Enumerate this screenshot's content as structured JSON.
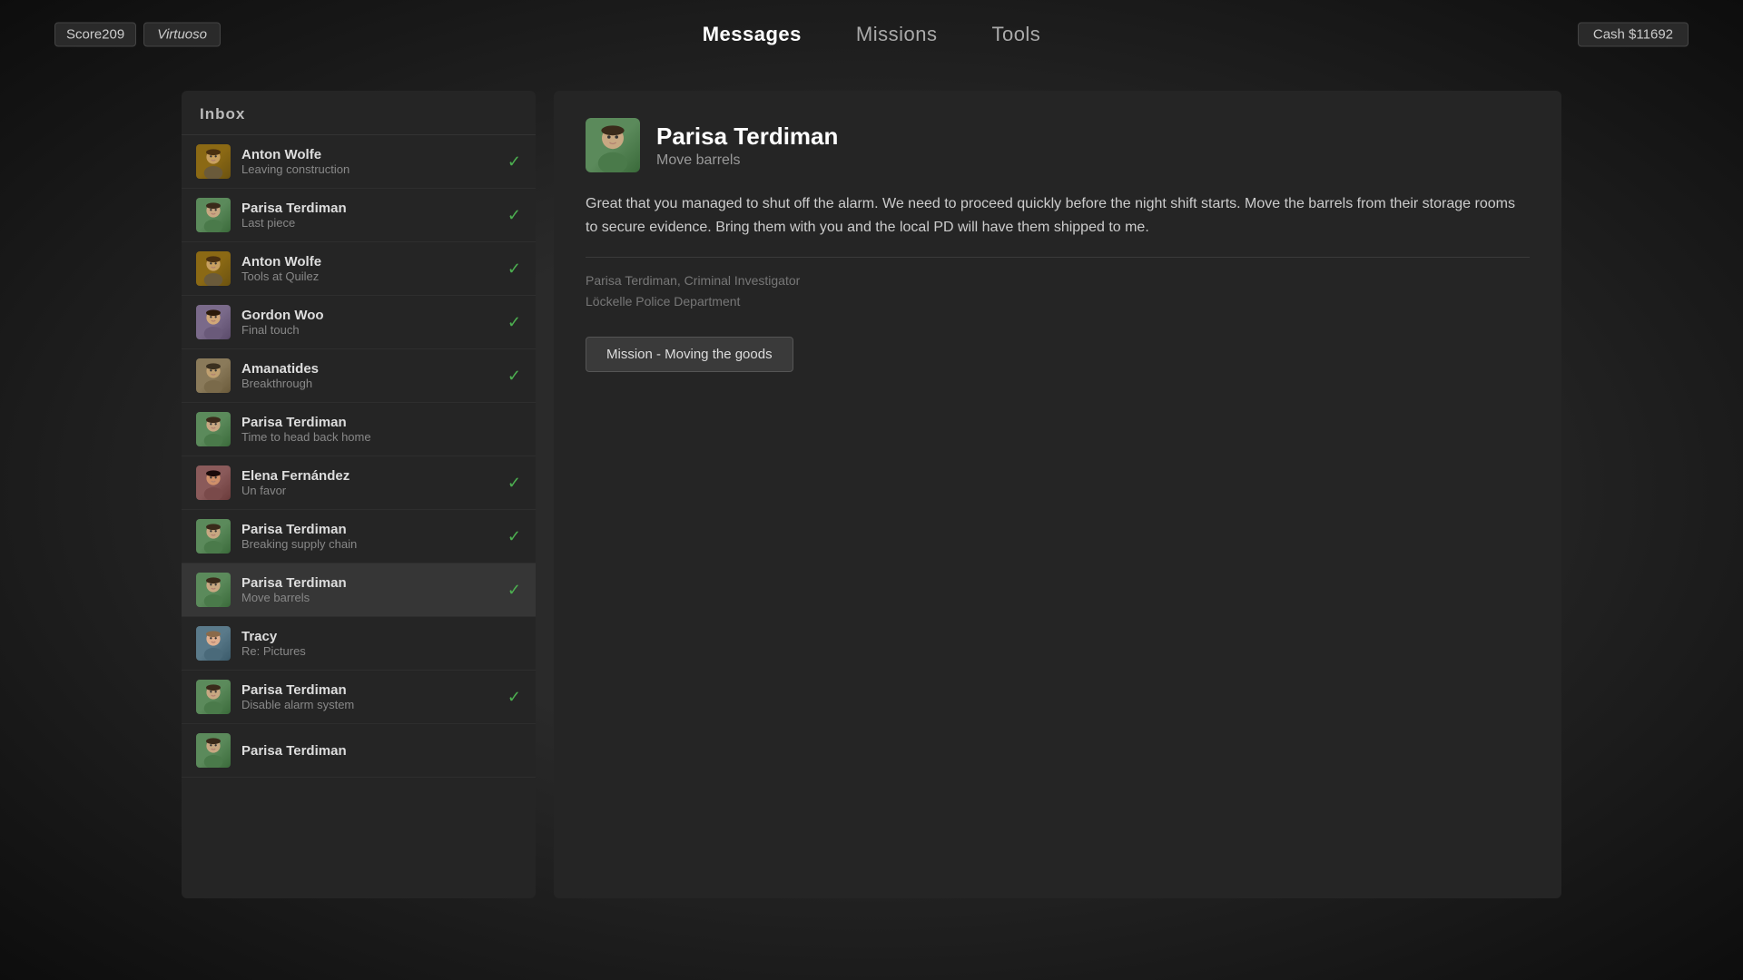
{
  "score": {
    "label": "Score209",
    "rank": "Virtuoso"
  },
  "cash": {
    "label": "Cash $11692"
  },
  "nav": {
    "tabs": [
      {
        "id": "messages",
        "label": "Messages",
        "active": true
      },
      {
        "id": "missions",
        "label": "Missions",
        "active": false
      },
      {
        "id": "tools",
        "label": "Tools",
        "active": false
      }
    ]
  },
  "inbox": {
    "title": "Inbox",
    "items": [
      {
        "id": 0,
        "name": "Anton Wolfe",
        "subject": "Leaving construction",
        "checked": true,
        "selected": false,
        "avatar_class": "av-anton"
      },
      {
        "id": 1,
        "name": "Parisa Terdiman",
        "subject": "Last piece",
        "checked": true,
        "selected": false,
        "avatar_class": "av-parisa"
      },
      {
        "id": 2,
        "name": "Anton Wolfe",
        "subject": "Tools at Quilez",
        "checked": true,
        "selected": false,
        "avatar_class": "av-anton"
      },
      {
        "id": 3,
        "name": "Gordon Woo",
        "subject": "Final touch",
        "checked": true,
        "selected": false,
        "avatar_class": "av-gordon"
      },
      {
        "id": 4,
        "name": "Amanatides",
        "subject": "Breakthrough",
        "checked": true,
        "selected": false,
        "avatar_class": "av-amanatides"
      },
      {
        "id": 5,
        "name": "Parisa Terdiman",
        "subject": "Time to head back home",
        "checked": false,
        "selected": false,
        "avatar_class": "av-parisa"
      },
      {
        "id": 6,
        "name": "Elena Fernández",
        "subject": "Un favor",
        "checked": true,
        "selected": false,
        "avatar_class": "av-elena"
      },
      {
        "id": 7,
        "name": "Parisa Terdiman",
        "subject": "Breaking supply chain",
        "checked": true,
        "selected": false,
        "avatar_class": "av-parisa"
      },
      {
        "id": 8,
        "name": "Parisa Terdiman",
        "subject": "Move barrels",
        "checked": true,
        "selected": true,
        "avatar_class": "av-parisa"
      },
      {
        "id": 9,
        "name": "Tracy",
        "subject": "Re: Pictures",
        "checked": false,
        "selected": false,
        "avatar_class": "av-tracy"
      },
      {
        "id": 10,
        "name": "Parisa Terdiman",
        "subject": "Disable alarm system",
        "checked": true,
        "selected": false,
        "avatar_class": "av-parisa"
      },
      {
        "id": 11,
        "name": "Parisa Terdiman",
        "subject": "",
        "checked": false,
        "selected": false,
        "avatar_class": "av-parisa"
      }
    ]
  },
  "detail": {
    "sender": "Parisa Terdiman",
    "subject": "Move barrels",
    "body": "Great that you managed to shut off the alarm. We need to proceed quickly before the night shift starts. Move the barrels from their storage rooms to secure evidence. Bring them with you and the local PD will have them shipped to me.",
    "signature_line1": "Parisa Terdiman, Criminal Investigator",
    "signature_line2": "Löckelle Police Department",
    "mission_button": "Mission - Moving the goods"
  }
}
